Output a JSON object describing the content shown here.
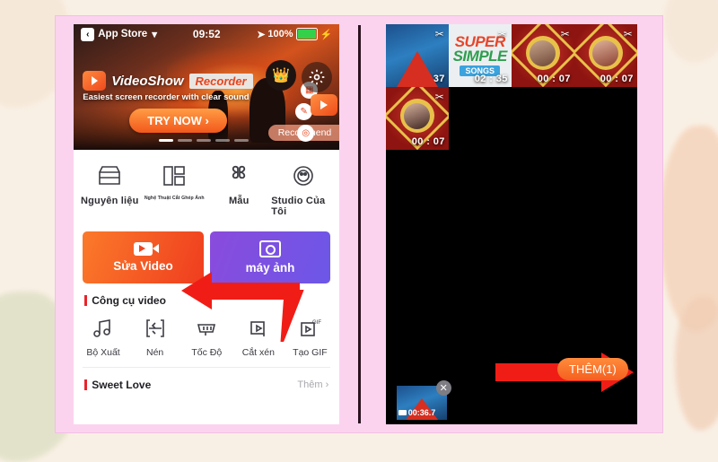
{
  "theme": {
    "background": "#f9f0e5",
    "frame_pink": "#fbd3ef",
    "accent_orange": "#f2581c",
    "accent_purple": "#6c57e8",
    "arrow_red": "#f01d16"
  },
  "left_phone": {
    "status_bar": {
      "back_label": "App Store",
      "back_icon": "chevron-left-icon",
      "wifi_icon": "wifi-icon",
      "time": "09:52",
      "location_icon": "location-arrow-icon",
      "battery_percent": "100%",
      "charging_icon": "bolt-icon"
    },
    "banner": {
      "app_name": "VideoShow",
      "badge": "Recorder",
      "subtitle": "Easiest screen recorder with clear sound",
      "cta": "TRY NOW ›",
      "recommend_tag": "Recommend",
      "crown_icon": "crown-icon",
      "gear_icon": "gear-icon",
      "video_icon": "video-camera-icon",
      "mini_icons": [
        "grid-icon",
        "pencil-icon",
        "target-icon"
      ],
      "dots_total": 5,
      "dots_active": 1
    },
    "nav_items": [
      {
        "label": "Nguyên liệu",
        "icon": "store-icon",
        "tiny": false
      },
      {
        "label": "Nghệ Thuật Cắt Ghép Ảnh",
        "icon": "collage-icon",
        "tiny": true
      },
      {
        "label": "Mẫu",
        "icon": "template-icon",
        "tiny": false
      },
      {
        "label": "Studio Của Tôi",
        "icon": "studio-icon",
        "tiny": false
      }
    ],
    "actions": [
      {
        "label": "Sửa Video",
        "icon": "video-camera-icon"
      },
      {
        "label": "máy ảnh",
        "icon": "camera-icon"
      }
    ],
    "tools_section": {
      "title": "Công cụ video",
      "items": [
        {
          "label": "Bộ Xuất",
          "icon": "music-note-icon"
        },
        {
          "label": "Nén",
          "icon": "compress-icon"
        },
        {
          "label": "Tốc Độ",
          "icon": "speed-icon"
        },
        {
          "label": "Cắt xén",
          "icon": "crop-icon"
        },
        {
          "label": "Tạo GIF",
          "icon": "gif-icon"
        }
      ]
    },
    "sweet_love": {
      "title": "Sweet Love",
      "more": "Thêm ›"
    }
  },
  "right_phone": {
    "thumbnails": [
      {
        "duration": "00 : 37",
        "style": "blue-keyboard",
        "scissors_icon": "scissors-icon"
      },
      {
        "duration": "02 : 35",
        "style": "super-simple-songs",
        "scissors_icon": "scissors-icon",
        "title_line1": "SUPER",
        "title_line2": "SIMPLE",
        "title_line3": "SONGS"
      },
      {
        "duration": "00 : 07",
        "style": "red-gold-portrait",
        "scissors_icon": "scissors-icon"
      },
      {
        "duration": "00 : 07",
        "style": "red-gold-portrait",
        "scissors_icon": "scissors-icon"
      },
      {
        "duration": "00 : 07",
        "style": "red-gold-portrait",
        "scissors_icon": "scissors-icon"
      }
    ],
    "add_button": "THÊM(1)",
    "selected_clip": {
      "duration": "00:36.7",
      "remove_icon": "close-icon",
      "video_icon": "video-camera-icon"
    }
  }
}
